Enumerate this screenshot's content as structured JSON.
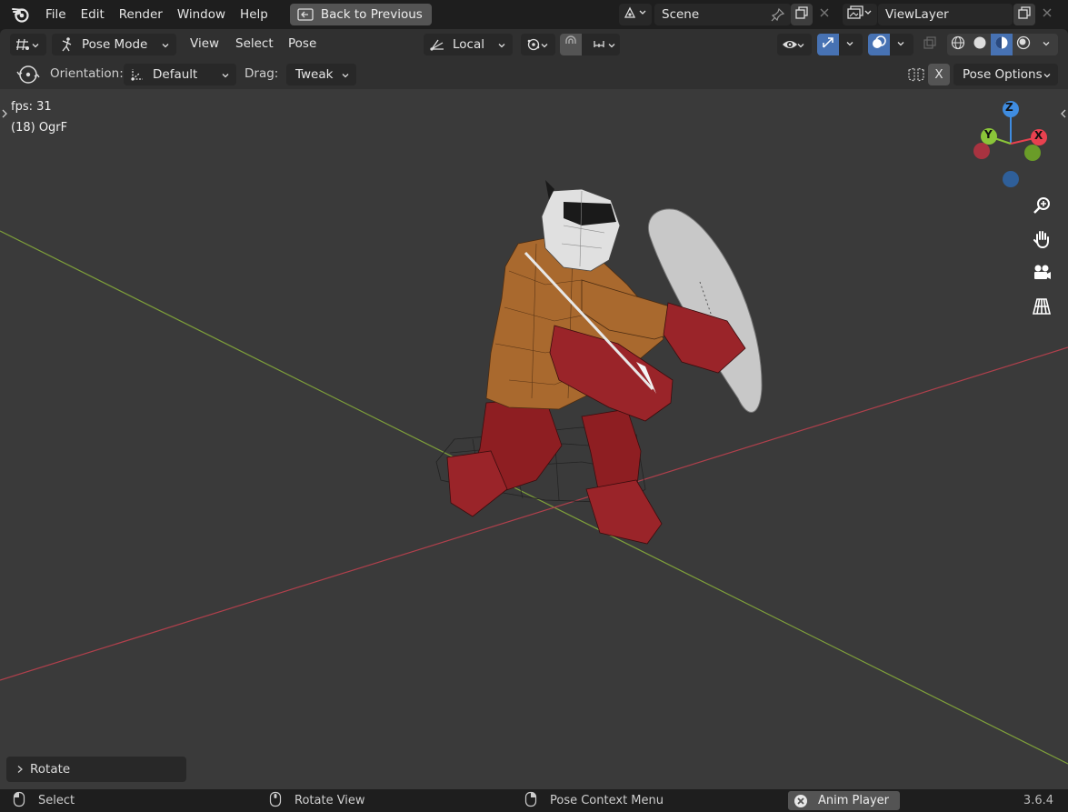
{
  "topbar": {
    "menus": [
      "File",
      "Edit",
      "Render",
      "Window",
      "Help"
    ],
    "back_button": "Back to Previous",
    "scene_name": "Scene",
    "view_layer_name": "ViewLayer"
  },
  "header": {
    "mode": "Pose Mode",
    "menus": [
      "View",
      "Select",
      "Pose"
    ],
    "transform_orientation": "Local"
  },
  "tool_settings": {
    "orientation_label": "Orientation:",
    "orientation_value": "Default",
    "drag_label": "Drag:",
    "drag_value": "Tweak",
    "x_mirror": "X",
    "pose_options": "Pose Options"
  },
  "viewport": {
    "fps": "fps: 31",
    "object_info": "(18) OgrF",
    "gizmo_axes": [
      "Z",
      "Y",
      "X"
    ],
    "last_operator": "Rotate"
  },
  "statusbar": {
    "select": "Select",
    "rotate_view": "Rotate View",
    "context_menu": "Pose Context Menu",
    "anim_player": "Anim Player",
    "version": "3.6.4"
  },
  "colors": {
    "accent": "#4772b3",
    "axis_x": "#e8414f",
    "axis_y": "#8ac539",
    "axis_z": "#3f8ce0",
    "viewport_bg": "#3a3a3a"
  }
}
